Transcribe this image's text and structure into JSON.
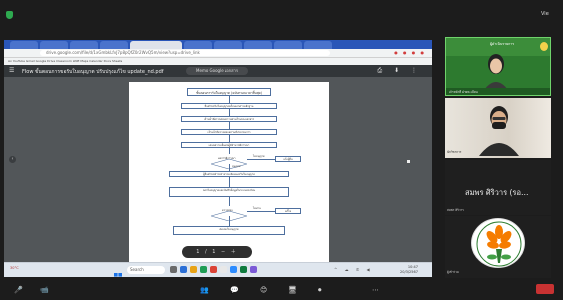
{
  "meeting": {
    "view_button": "Vie",
    "colors": {
      "background": "#1c1c1c",
      "security": "#2eaa50",
      "end": "#c83232",
      "active_speaker": "#6fd36b"
    }
  },
  "browser": {
    "url": "drive.google.com/file/d/1xGmbkLfvJ7p8pQfZ0r2WvQ5m/view?usp=drive_link",
    "bookmarks": "Ax  YouTube  Gmail  Google Drive  Classroom  LINE  Maps  Calendar  Docs  Sheets",
    "pdf_filename": "Flow ขั้นตอนการขอรับใบอนุญาต ปรับปรุงแก้ไข update_nd.pdf",
    "pdf_page_indicator": "Memo Google เอกสาร",
    "pdf_actions": "⎙ ⬇ ⋮",
    "sidebar_toggle": "‹",
    "zoom_control": "1 / 1 − ＋"
  },
  "flowchart": {
    "title": "ขั้นตอนการรับใบอนุญาต (ฉบับกรอบเวลาสิ้นสุด)",
    "steps": [
      "ยื่นคำขอรับใบอนุญาตพร้อมเอกสารหลักฐาน",
      "เจ้าหน้าที่ตรวจสอบความครบถ้วนของเอกสาร",
      "เจ้าหน้าที่ตรวจสอบสถานที่ประกอบการ",
      "เสนอความเห็นต่อผู้มีอำนาจพิจารณา"
    ],
    "decision_1": "ผลการพิจารณา",
    "decision_1_yes": "ไม่อนุญาต",
    "decision_1_side": "แจ้งผู้ยื่น",
    "decision_1_no": "อนุญาต",
    "step_after": "ผู้ยื่นคำขอชำระค่าธรรมเนียมและรับใบอนุญาต",
    "step_final": "ออกใบอนุญาตและบันทึกข้อมูลในระบบทะเบียน",
    "decision_2": "ตรวจสอบ",
    "decision_2_yes": "ไม่ผ่าน",
    "decision_2_side": "แก้ไข",
    "bottom_box": "ส่งมอบใบอนุญาต"
  },
  "taskbar": {
    "weather": "30°C",
    "search": "Search",
    "clock_time": "10:47",
    "clock_date": "20/3/2567"
  },
  "participants": {
    "tile1_banner": "ผู้ดำเนินรายการ",
    "tile1_name": "เจ้าหน้าที่ ฝ่ายทะเบียน",
    "tile2_name": "นักวิชาการ",
    "tile3_name": "สมพร ศิริวาร (รอ…",
    "tile3_sub": "สมพร ศิริวาร",
    "tile4_sub": "ผู้เข้าร่วม"
  },
  "controls": [
    "🎤",
    "📹",
    "👥",
    "💬",
    "😊",
    "🖥",
    "⏺",
    "⋯"
  ]
}
